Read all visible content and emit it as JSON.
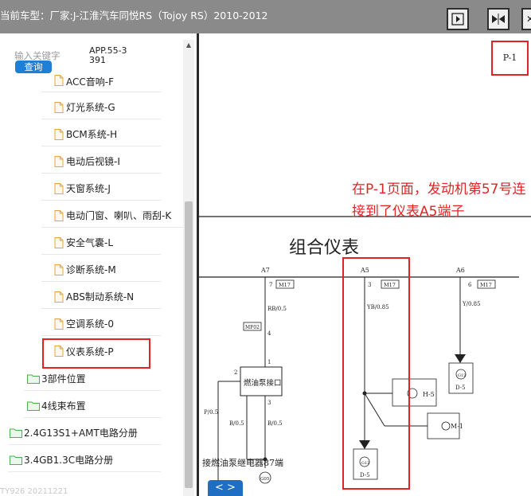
{
  "header": {
    "title": "当前车型：厂家:J-江淮汽车同悦RS（Tojoy RS）2010-2012",
    "buttons": [
      {
        "name": "single-page",
        "icon": "page-right-icon"
      },
      {
        "name": "split-view",
        "icon": "split-arrows-icon"
      },
      {
        "name": "close",
        "icon": "close-icon"
      }
    ]
  },
  "sidebar": {
    "search": {
      "placeholder": "输入关键字",
      "button_label": "查询"
    },
    "app_code": "APP.55-3391",
    "items": [
      {
        "label": "ACC音响-F",
        "type": "file"
      },
      {
        "label": "灯光系统-G",
        "type": "file"
      },
      {
        "label": "BCM系统-H",
        "type": "file"
      },
      {
        "label": "电动后视镜-I",
        "type": "file"
      },
      {
        "label": "天窗系统-J",
        "type": "file"
      },
      {
        "label": "电动门窗、喇叭、雨刮-K",
        "type": "file"
      },
      {
        "label": "安全气囊-L",
        "type": "file"
      },
      {
        "label": "诊断系统-M",
        "type": "file"
      },
      {
        "label": "ABS制动系统-N",
        "type": "file"
      },
      {
        "label": "空调系统-0",
        "type": "file"
      },
      {
        "label": "仪表系统-P",
        "type": "file",
        "selected": true
      },
      {
        "label": "3部件位置",
        "type": "folder"
      },
      {
        "label": "4线束布置",
        "type": "folder"
      },
      {
        "label": "2.4G13S1+AMT电路分册",
        "type": "folder"
      },
      {
        "label": "3.4GB1.3C电路分册",
        "type": "folder"
      }
    ],
    "footer": "TY926 20211221"
  },
  "viewer": {
    "page_id": "P-1",
    "annotation": "在P-1页面，发动机第57号连接到了仪表A5端子",
    "nav_label": "< >",
    "diagram": {
      "title": "组合仪表",
      "terminals": [
        "A7",
        "A5",
        "A6"
      ],
      "pins": [
        "7",
        "3",
        "6"
      ],
      "connector": "M17",
      "wires": [
        "RB/0.5",
        "YB/0.85",
        "Y/0.85",
        "P/0.5",
        "B/0.5",
        "B/0.5"
      ],
      "pin_labels": [
        "2",
        "4",
        "1",
        "3"
      ],
      "connector_mf02": "MF02",
      "box_label": "燃油泵接口",
      "grounds": [
        "G12",
        "D-5",
        "H-5",
        "M-1",
        "G12",
        "D-5"
      ],
      "bottom_label": "接燃油泵继电器87端",
      "bottom_ground": "G05"
    }
  },
  "colors": {
    "header_bg": "#8a8a8a",
    "accent": "#1e7fd6",
    "annotation": "#e02424",
    "folder": "#4caf50"
  }
}
